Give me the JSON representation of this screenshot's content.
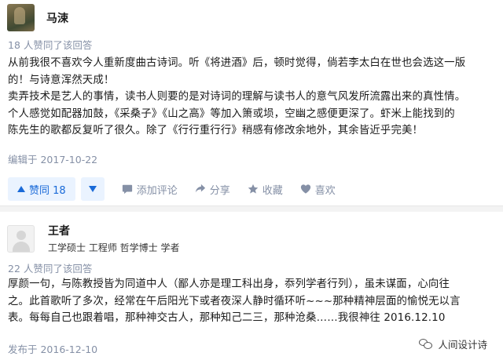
{
  "answer1": {
    "author": {
      "name": "马涑"
    },
    "vote_count_text": "18 人赞同了该回答",
    "content": [
      "从前我很不喜欢今人重新度曲古诗词。听《将进酒》后，顿时觉得，倘若李太白在世也会选这一版",
      "的！与诗意浑然天成！",
      "卖弄技术是艺人的事情，读书人则要的是对诗词的理解与读书人的意气风发所流露出来的真性情。",
      "个人感觉如配器加鼓，《采桑子》《山之高》等加入箫或埙，空幽之感便更深了。虾米上能找到的",
      "陈先生的歌都反复听了很久。除了《行行重行行》稍感有修改余地外，其余皆近乎完美！"
    ],
    "edit_date": "编辑于 2017-10-22",
    "actions": {
      "vote_label": "赞同 18",
      "comment_label": "添加评论",
      "share_label": "分享",
      "collect_label": "收藏",
      "like_label": "喜欢"
    }
  },
  "answer2": {
    "author": {
      "name": "王者",
      "info": "工学硕士 工程师 哲学博士 学者"
    },
    "vote_count_text": "22 人赞同了该回答",
    "content": [
      "厚颜一句，与陈教授皆为同道中人（鄙人亦是理工科出身，忝列学者行列），虽未谋面，心向往",
      "之。此首歌听了多次，经常在午后阳光下或者夜深人静时循环听~~~那种精神层面的愉悦无以言",
      "表。每每自己也跟着唱，那种神交古人，那种知己二三，那种沧桑……我很神往 2016.12.10"
    ],
    "publish_date": "发布于 2016-12-10"
  },
  "watermark": {
    "text": "人间设计诗"
  },
  "icons": {
    "vote_up": "triangle-up-icon",
    "vote_down": "triangle-down-icon",
    "comment": "comment-bubble-icon",
    "share": "share-arrow-icon",
    "collect": "star-icon",
    "like": "heart-icon",
    "watermark_logo": "wechat-logo-icon"
  },
  "colors": {
    "accent": "#1a6ad8",
    "accent_bg": "#eaf3ff",
    "meta": "#8590a6"
  }
}
